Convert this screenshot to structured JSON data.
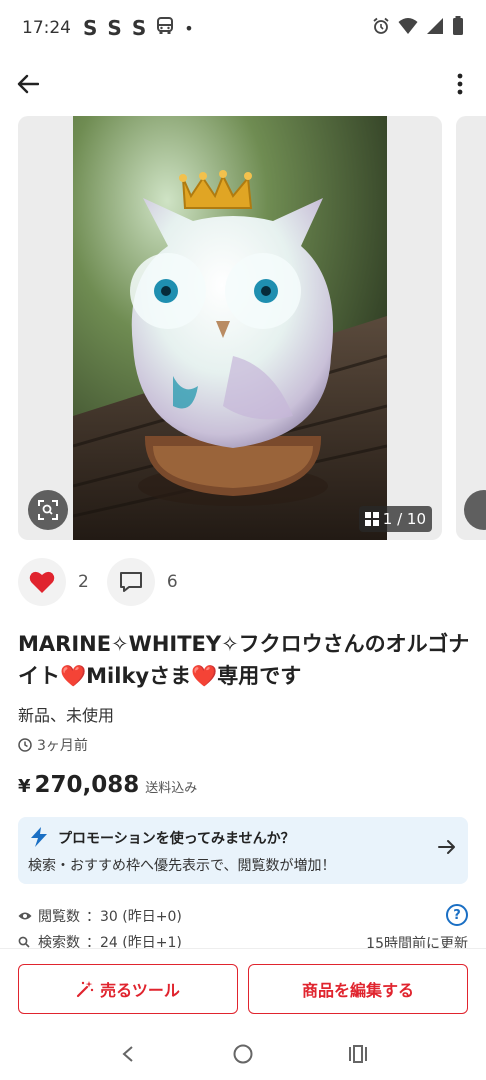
{
  "status_bar": {
    "time": "17:24",
    "s_icons": [
      "S",
      "S",
      "S"
    ],
    "dot": "•"
  },
  "carousel": {
    "counter": "1 / 10"
  },
  "reactions": {
    "likes": "2",
    "comments": "6"
  },
  "product": {
    "title_part1": "MARINE✧WHITEY✧フクロウさんのオルゴナイト",
    "heart1": "❤️",
    "title_part2": "Milkyさま",
    "heart2": "❤️",
    "title_part3": "専用です",
    "condition": "新品、未使用",
    "posted": "3ヶ月前",
    "price_symbol": "¥",
    "price": "270,088",
    "shipping": "送料込み"
  },
  "promo": {
    "title": "プロモーションを使ってみませんか？",
    "body": "検索・おすすめ枠へ優先表示で、閲覧数が増加！"
  },
  "stats": {
    "views_label": "閲覧数",
    "views_value": "：30 (昨日+0)",
    "search_label": "検索数",
    "search_value": "：24 (昨日+1)",
    "help": "?",
    "updated": "15時間前に更新"
  },
  "buttons": {
    "sell_tools": "売るツール",
    "edit_item": "商品を編集する"
  },
  "colors": {
    "accent": "#e0242e",
    "promo_bg": "#e9f3fb",
    "link_blue": "#1a6fc4"
  }
}
